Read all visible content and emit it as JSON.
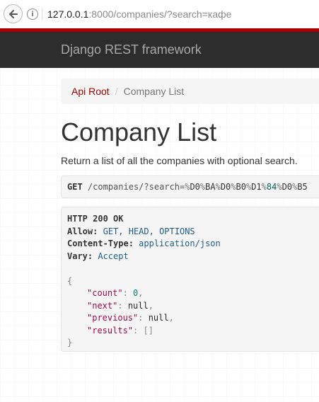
{
  "browser": {
    "url_host": "127.0.0.1",
    "url_rest": ":8000/companies/?search=кафе"
  },
  "navbar": {
    "brand": "Django REST framework"
  },
  "breadcrumb": {
    "root_label": "Api Root",
    "separator": "/",
    "current_label": "Company List"
  },
  "page": {
    "title": "Company List",
    "description": "Return a list of all the companies with optional search."
  },
  "request": {
    "method": "GET",
    "path": "/companies/",
    "query_start": "?search=",
    "encoded": [
      {
        "pct": "%",
        "val": "D0"
      },
      {
        "pct": "%",
        "val": "BA"
      },
      {
        "pct": "%",
        "val": "D0"
      },
      {
        "pct": "%",
        "val": "B0"
      },
      {
        "pct": "%",
        "val": "D1"
      },
      {
        "pct": "%",
        "val": "84"
      },
      {
        "pct": "%",
        "val": "D0"
      },
      {
        "pct": "%",
        "val": "B5"
      }
    ]
  },
  "response": {
    "status": "HTTP 200 OK",
    "headers": [
      {
        "name": "Allow:",
        "value": "GET, HEAD, OPTIONS"
      },
      {
        "name": "Content-Type:",
        "value": "application/json"
      },
      {
        "name": "Vary:",
        "value": "Accept"
      }
    ],
    "body": {
      "open": "{",
      "close": "}",
      "fields": [
        {
          "key": "\"count\"",
          "value": "0",
          "type": "num",
          "comma": ","
        },
        {
          "key": "\"next\"",
          "value": "null",
          "type": "null",
          "comma": ","
        },
        {
          "key": "\"previous\"",
          "value": "null",
          "type": "null",
          "comma": ","
        },
        {
          "key": "\"results\"",
          "value": "[]",
          "type": "arr",
          "comma": ""
        }
      ]
    }
  },
  "colors": {
    "navbar_bg": "#2d2d2d",
    "navbar_accent": "#ac0000",
    "link": "#a30000",
    "json_key": "#a30c4b",
    "header_value": "#1f5f8b"
  }
}
